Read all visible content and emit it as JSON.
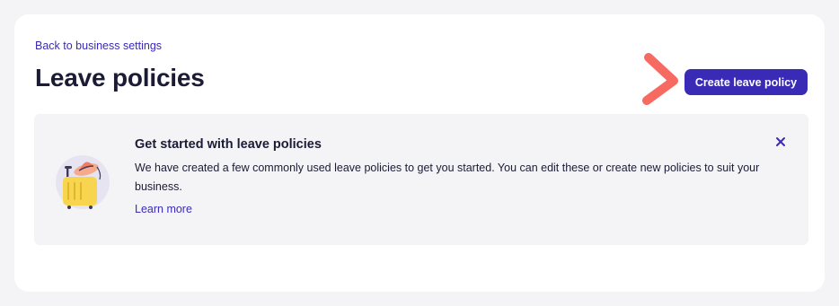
{
  "header": {
    "back_link": "Back to business settings",
    "title": "Leave policies",
    "create_button": "Create leave policy"
  },
  "banner": {
    "title": "Get started with leave policies",
    "text": "We have created a few commonly used leave policies to get you started. You can edit these or create new policies to suit your business.",
    "learn_more": "Learn more"
  },
  "icons": {
    "illustration": "suitcase-sunhat-illustration",
    "close": "close-icon",
    "annotation": "chevron-arrow-icon"
  },
  "colors": {
    "accent": "#3a2bb7",
    "annotation": "#f76a62",
    "banner_bg": "#f4f4f7",
    "text": "#1b1b35"
  }
}
